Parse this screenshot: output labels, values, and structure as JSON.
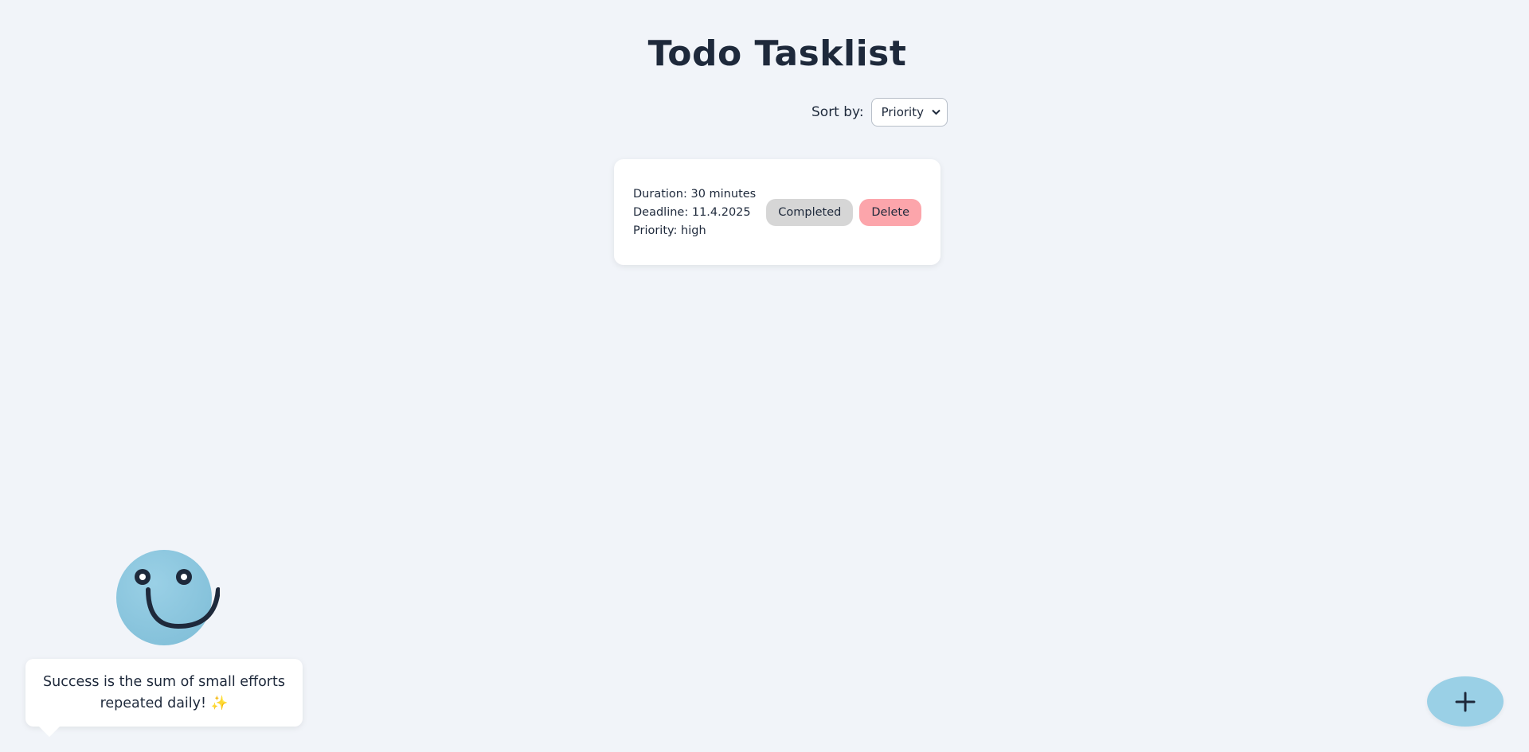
{
  "header": {
    "title": "Todo Tasklist"
  },
  "sort": {
    "label": "Sort by:",
    "selected": "Priority"
  },
  "tasks": [
    {
      "duration": "Duration: 30 minutes",
      "deadline": "Deadline: 11.4.2025",
      "priority": "Priority: high",
      "completed_label": "Completed",
      "delete_label": "Delete"
    }
  ],
  "mascot": {
    "message": "Success is the sum of small efforts repeated daily! ✨"
  },
  "fab": {
    "icon": "plus-icon"
  },
  "colors": {
    "background": "#f1f4f9",
    "text": "#1e293b",
    "accent": "#9ad0e6",
    "delete": "#fca5ab",
    "completed": "#d6d6d6"
  }
}
